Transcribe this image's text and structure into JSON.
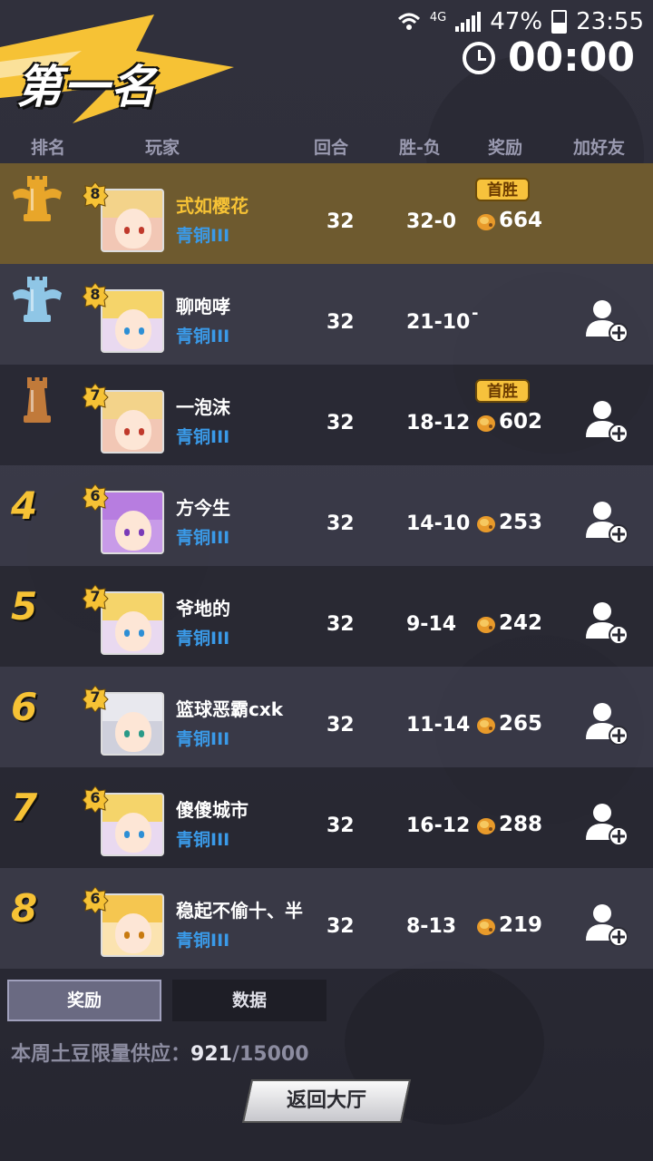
{
  "status_bar": {
    "network": "4G",
    "battery": "47%",
    "time": "23:55"
  },
  "banner": {
    "title": "第一名"
  },
  "timer": {
    "value": "00:00"
  },
  "table_header": {
    "rank": "排名",
    "player": "玩家",
    "rounds": "回合",
    "win_loss": "胜-负",
    "reward": "奖励",
    "add_friend": "加好友"
  },
  "rows": [
    {
      "rank": "1",
      "level": "8",
      "name": "式如樱花",
      "tier": "青铜III",
      "rounds": "32",
      "win_loss": "32-0",
      "reward": "664",
      "badge": "首胜"
    },
    {
      "rank": "2",
      "level": "8",
      "name": "聊咆哮",
      "tier": "青铜III",
      "rounds": "32",
      "win_loss": "21-10",
      "reward": "-",
      "badge": ""
    },
    {
      "rank": "3",
      "level": "7",
      "name": "一泡沫",
      "tier": "青铜III",
      "rounds": "32",
      "win_loss": "18-12",
      "reward": "602",
      "badge": "首胜"
    },
    {
      "rank": "4",
      "level": "6",
      "name": "方今生",
      "tier": "青铜III",
      "rounds": "32",
      "win_loss": "14-10",
      "reward": "253",
      "badge": ""
    },
    {
      "rank": "5",
      "level": "7",
      "name": "爷地的",
      "tier": "青铜III",
      "rounds": "32",
      "win_loss": "9-14",
      "reward": "242",
      "badge": ""
    },
    {
      "rank": "6",
      "level": "7",
      "name": "篮球恶霸cxk",
      "tier": "青铜III",
      "rounds": "32",
      "win_loss": "11-14",
      "reward": "265",
      "badge": ""
    },
    {
      "rank": "7",
      "level": "6",
      "name": "傻傻城市",
      "tier": "青铜III",
      "rounds": "32",
      "win_loss": "16-12",
      "reward": "288",
      "badge": ""
    },
    {
      "rank": "8",
      "level": "6",
      "name": "稳起不偷十、半",
      "tier": "青铜III",
      "rounds": "32",
      "win_loss": "8-13",
      "reward": "219",
      "badge": ""
    }
  ],
  "tabs": {
    "reward": "奖励",
    "data": "数据"
  },
  "supply": {
    "label": "本周土豆限量供应：",
    "current": "921",
    "total": "/15000"
  },
  "return_button": {
    "label": "返回大厅"
  }
}
